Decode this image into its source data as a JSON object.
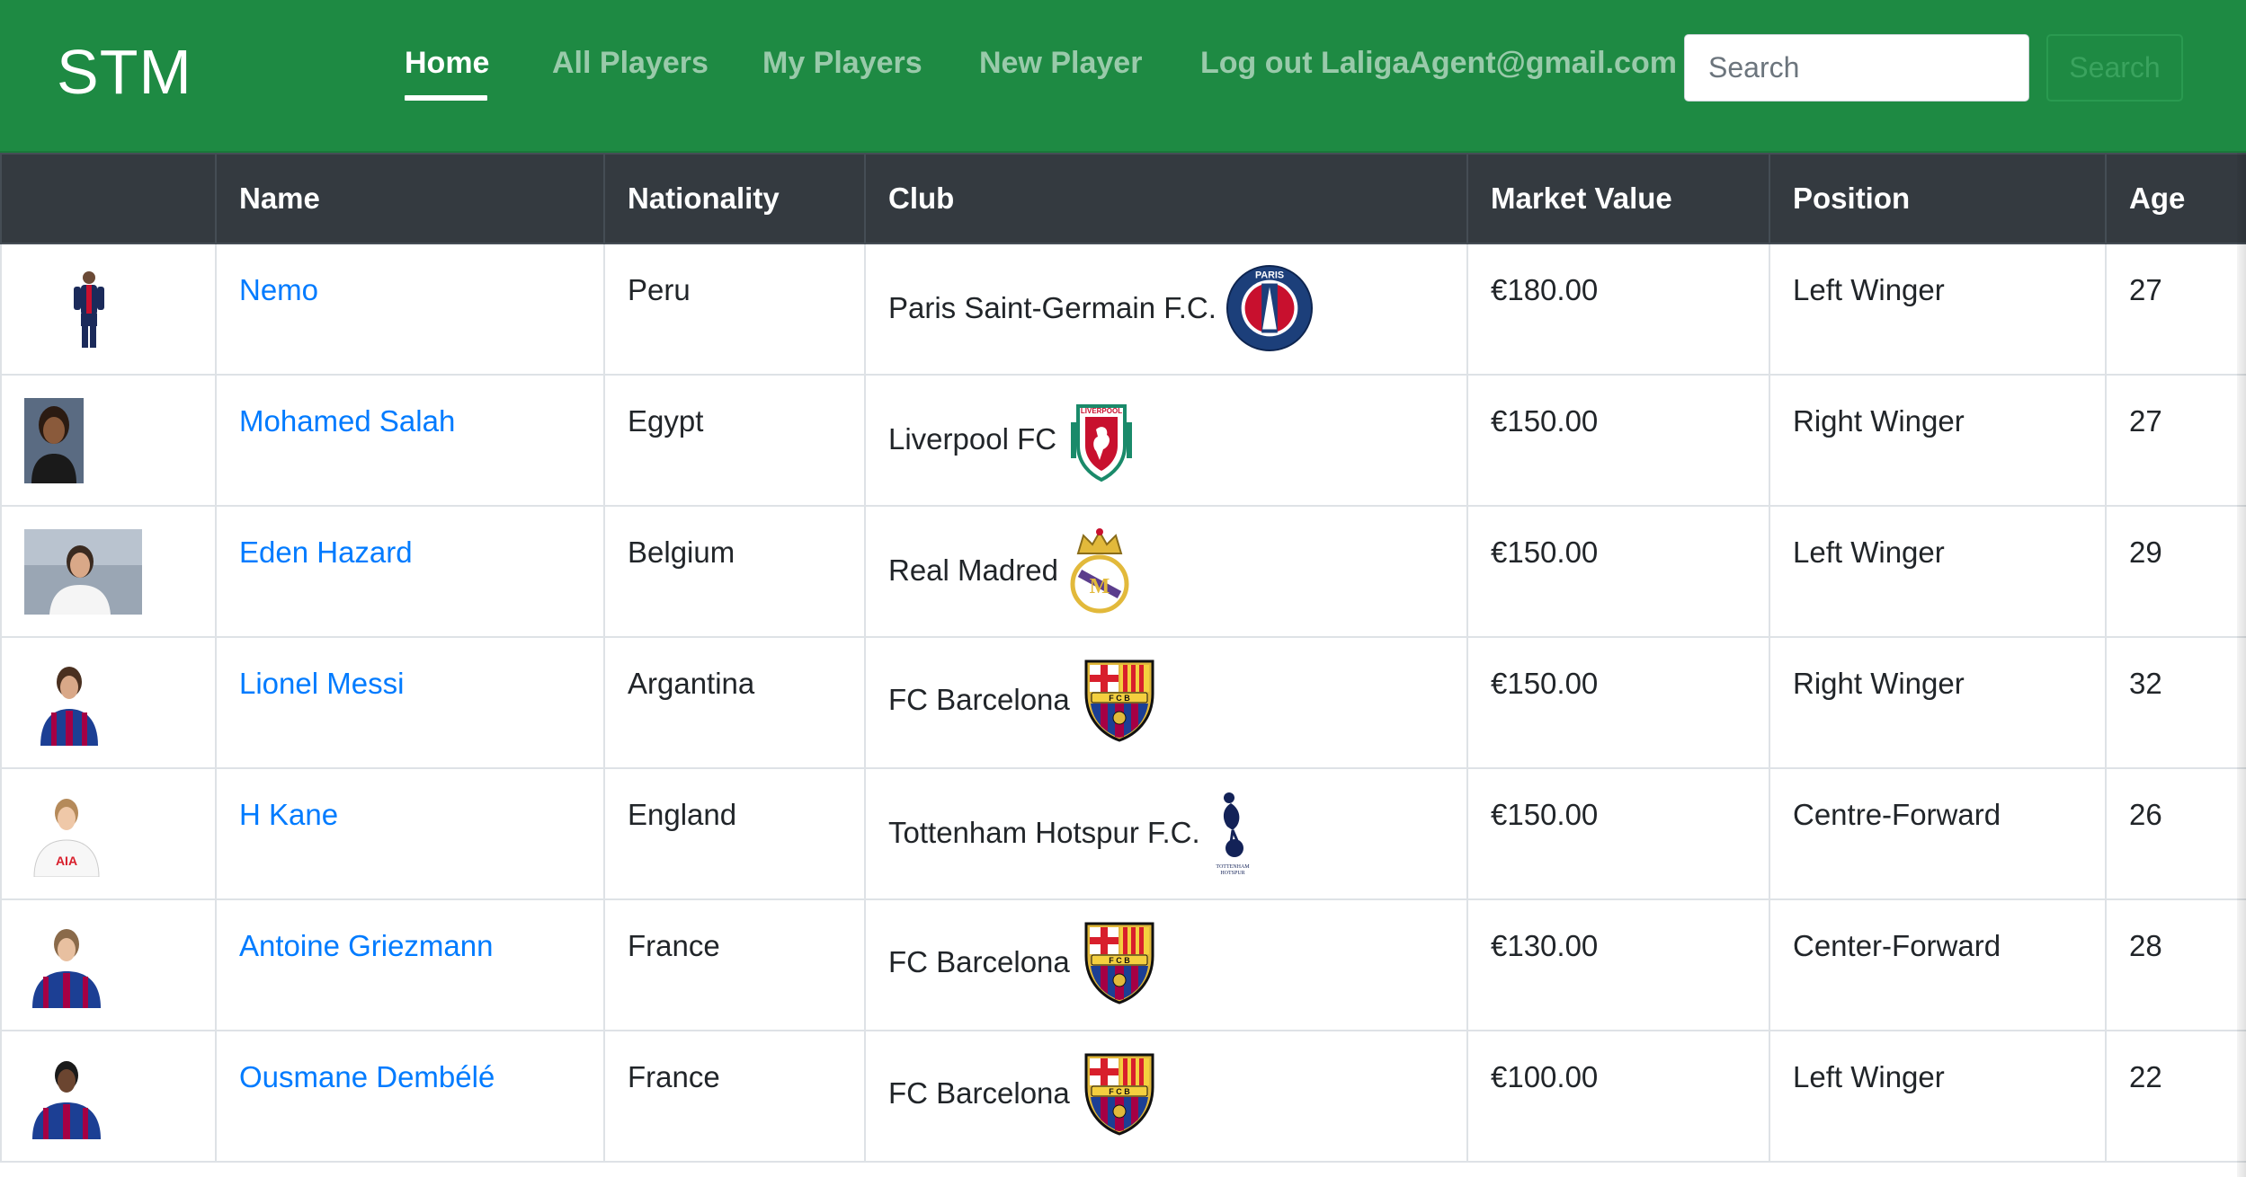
{
  "navbar": {
    "brand": "STM",
    "links": [
      {
        "label": "Home",
        "active": true
      },
      {
        "label": "All Players"
      },
      {
        "label": "My Players"
      },
      {
        "label": "New Player"
      },
      {
        "label": "Log out LaligaAgent@gmail.com"
      }
    ],
    "search": {
      "placeholder": "Search",
      "button_label": "Search"
    },
    "colors": {
      "navbar_bg": "#1e8a43",
      "link": "#007bff",
      "table_header_bg": "#343a40"
    }
  },
  "table": {
    "headers": [
      "",
      "Name",
      "Nationality",
      "Club",
      "Market Value",
      "Position",
      "Age"
    ],
    "rows": [
      {
        "photo": "player-photo-full-body",
        "name": "Nemo",
        "nationality": "Peru",
        "club": "Paris Saint-Germain F.C.",
        "club_logo": "psg-crest-icon",
        "market_value": "€180.00",
        "position": "Left Winger",
        "age": "27"
      },
      {
        "photo": "player-photo-portrait",
        "name": "Mohamed Salah",
        "nationality": "Egypt",
        "club": "Liverpool FC",
        "club_logo": "liverpool-crest-icon",
        "market_value": "€150.00",
        "position": "Right Winger",
        "age": "27"
      },
      {
        "photo": "player-photo-landscape",
        "name": "Eden Hazard",
        "nationality": "Belgium",
        "club": "Real Madred",
        "club_logo": "real-madrid-crest-icon",
        "market_value": "€150.00",
        "position": "Left Winger",
        "age": "29"
      },
      {
        "photo": "player-photo-portrait",
        "name": "Lionel Messi",
        "nationality": "Argantina",
        "club": "FC Barcelona",
        "club_logo": "barcelona-crest-icon",
        "market_value": "€150.00",
        "position": "Right Winger",
        "age": "32"
      },
      {
        "photo": "player-photo-portrait",
        "name": "H Kane",
        "nationality": "England",
        "club": "Tottenham Hotspur F.C.",
        "club_logo": "tottenham-crest-icon",
        "market_value": "€150.00",
        "position": "Centre-Forward",
        "age": "26"
      },
      {
        "photo": "player-photo-portrait",
        "name": "Antoine Griezmann",
        "nationality": "France",
        "club": "FC Barcelona",
        "club_logo": "barcelona-crest-icon",
        "market_value": "€130.00",
        "position": "Center-Forward",
        "age": "28"
      },
      {
        "photo": "player-photo-portrait",
        "name": "Ousmane Dembélé",
        "nationality": "France",
        "club": "FC Barcelona",
        "club_logo": "barcelona-crest-icon",
        "market_value": "€100.00",
        "position": "Left Winger",
        "age": "22"
      }
    ]
  }
}
